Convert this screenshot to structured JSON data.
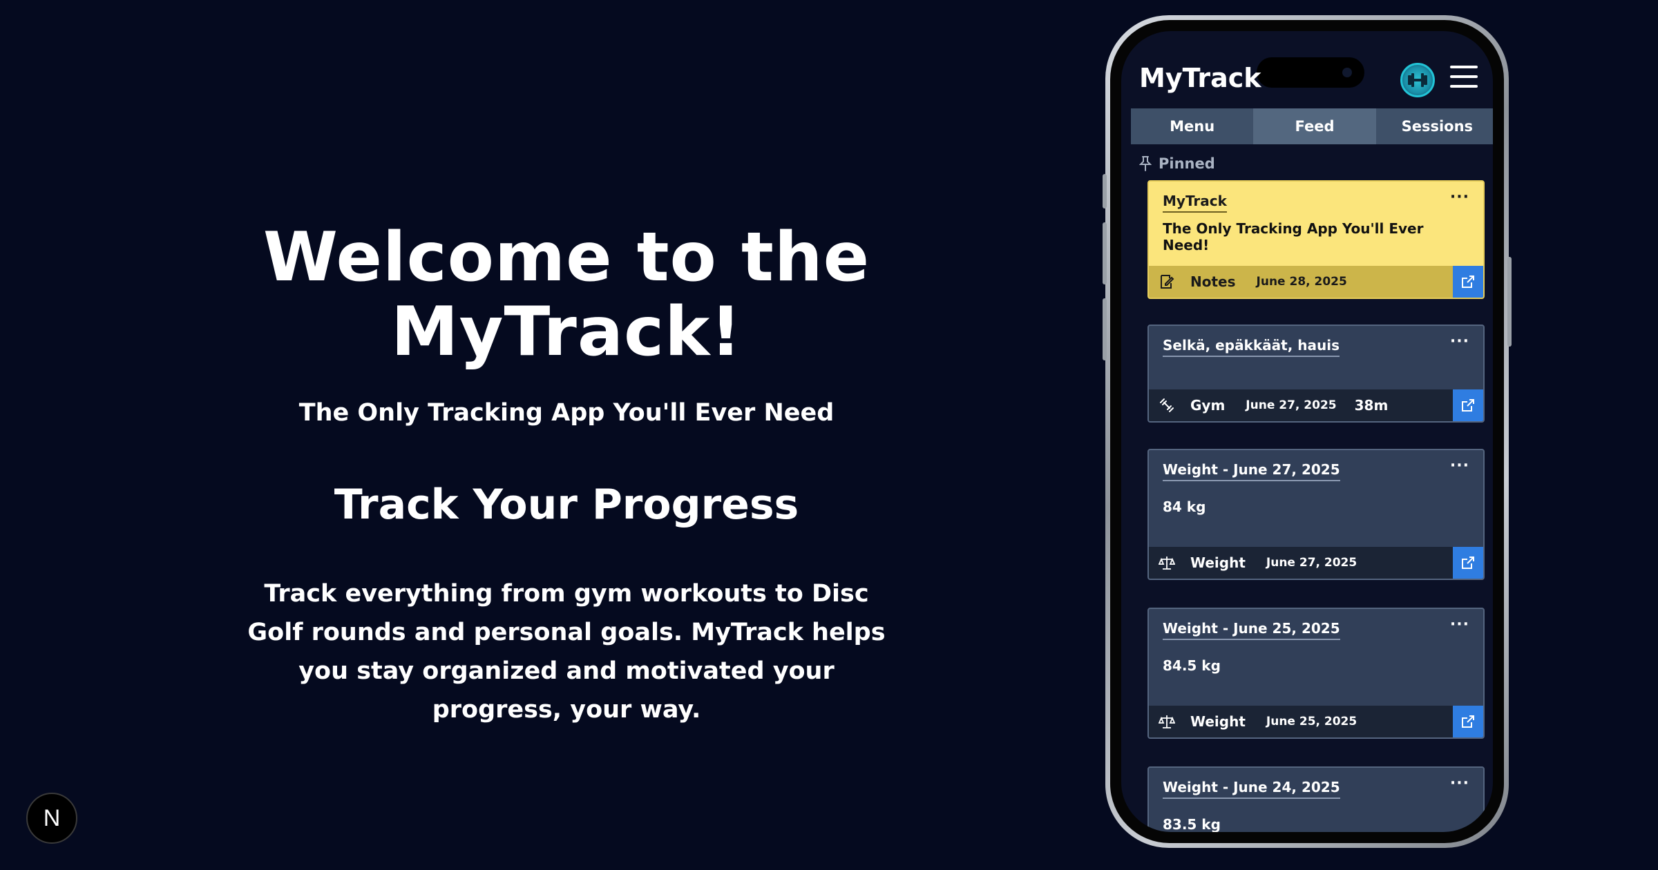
{
  "hero": {
    "title": "Welcome to the MyTrack!",
    "subtitle": "The Only Tracking App You'll Ever Need",
    "heading": "Track Your Progress",
    "body": "Track everything from gym workouts to Disc Golf rounds and personal goals. MyTrack helps you stay organized and motivated your progress, your way."
  },
  "badge": {
    "letter": "N"
  },
  "app": {
    "title": "MyTrack",
    "tabs": [
      {
        "label": "Menu"
      },
      {
        "label": "Feed"
      },
      {
        "label": "Sessions"
      }
    ],
    "pinned_label": "Pinned",
    "menu_glyph": "···",
    "cards": [
      {
        "title": "MyTrack",
        "body": "The Only Tracking App You'll Ever Need!",
        "type": "Notes",
        "date": "June 28, 2025",
        "icon": "notes-icon"
      },
      {
        "title": "Selkä, epäkkäät, hauis",
        "body": "",
        "type": "Gym",
        "date": "June 27, 2025",
        "duration": "38m",
        "icon": "dumbbell-icon"
      },
      {
        "title": "Weight - June 27, 2025",
        "body": "84 kg",
        "type": "Weight",
        "date": "June 27, 2025",
        "icon": "scale-icon"
      },
      {
        "title": "Weight - June 25, 2025",
        "body": "84.5 kg",
        "type": "Weight",
        "date": "June 25, 2025",
        "icon": "scale-icon"
      },
      {
        "title": "Weight - June 24, 2025",
        "body": "83.5 kg"
      }
    ]
  },
  "colors": {
    "background": "#050a1f",
    "pinned_card": "#fbe57c",
    "card": "#313f58",
    "accent": "#2f7de1"
  }
}
